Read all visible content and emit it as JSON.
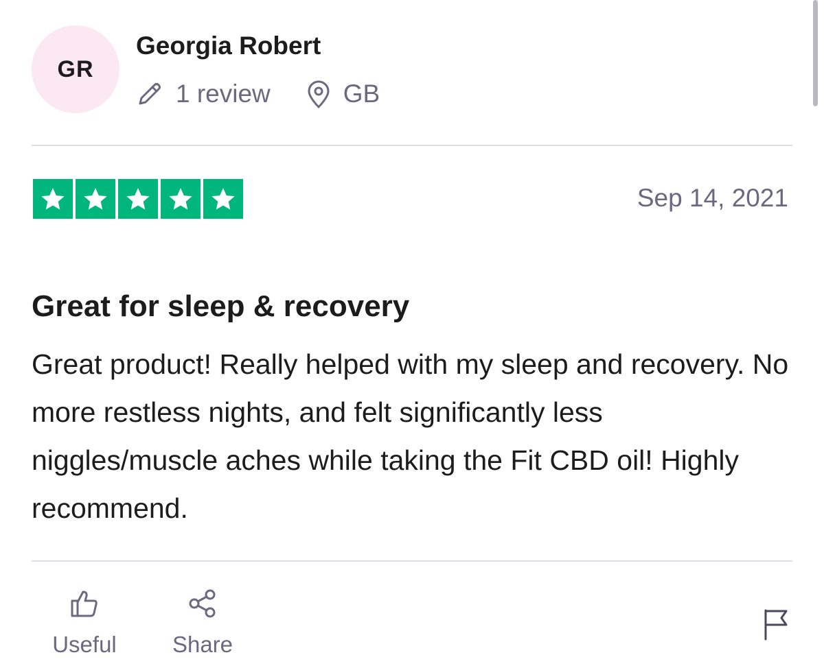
{
  "reviewer": {
    "initials": "GR",
    "name": "Georgia Robert",
    "review_count": "1 review",
    "country": "GB",
    "avatar_color": "#fce8f1"
  },
  "review": {
    "rating": 5,
    "max_rating": 5,
    "star_color": "#00b67a",
    "date": "Sep 14, 2021",
    "title": "Great for sleep & recovery",
    "body": "Great product! Really helped with my sleep and recovery. No more restless nights, and felt significantly less niggles/muscle aches while taking the Fit CBD oil! Highly recommend."
  },
  "actions": {
    "useful_label": "Useful",
    "share_label": "Share"
  },
  "icons": {
    "review_count": "pencil-icon",
    "country": "location-pin-icon",
    "useful": "thumbs-up-icon",
    "share": "share-icon",
    "report": "flag-icon"
  }
}
